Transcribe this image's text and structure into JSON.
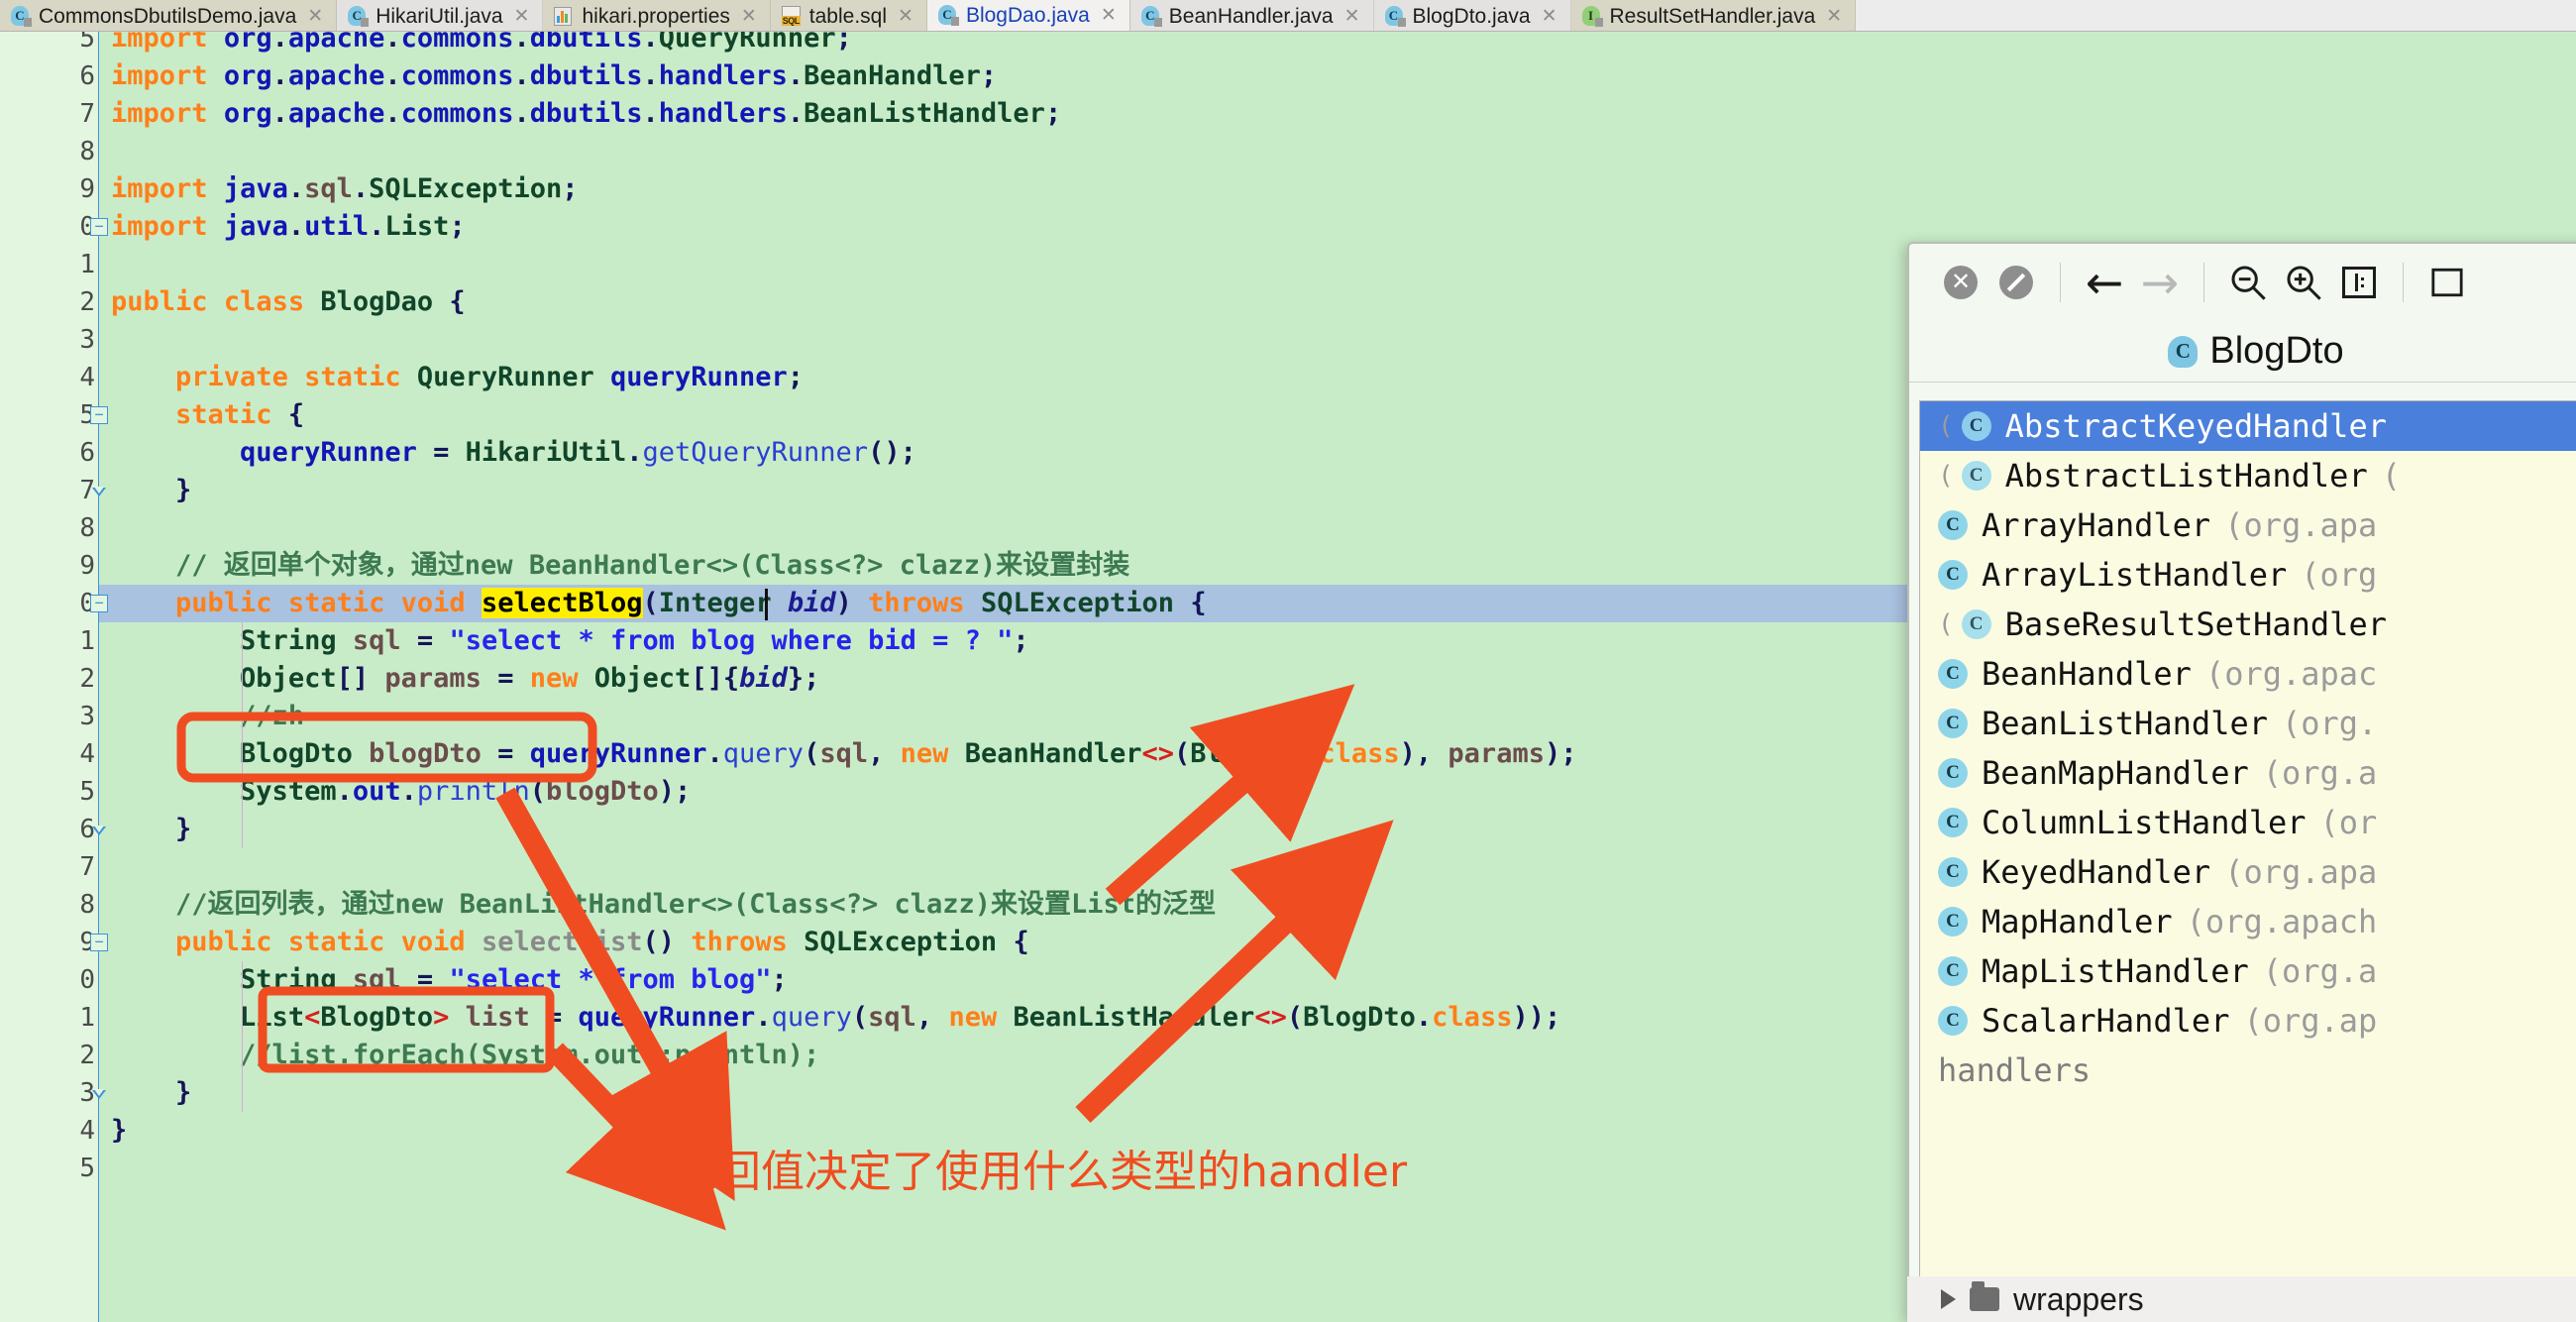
{
  "tabs": [
    {
      "label": "CommonsDbutilsDemo.java",
      "icon": "java-class-icon",
      "kind": "class",
      "active": false,
      "close": "✕"
    },
    {
      "label": "HikariUtil.java",
      "icon": "java-class-icon",
      "kind": "class",
      "active": false,
      "close": "✕"
    },
    {
      "label": "hikari.properties",
      "icon": "properties-file-icon",
      "kind": "props",
      "active": false,
      "close": "✕"
    },
    {
      "label": "table.sql",
      "icon": "sql-file-icon",
      "kind": "sql",
      "active": false,
      "close": "✕"
    },
    {
      "label": "BlogDao.java",
      "icon": "java-class-icon",
      "kind": "class",
      "active": true,
      "close": "✕"
    },
    {
      "label": "BeanHandler.java",
      "icon": "java-class-icon",
      "kind": "class",
      "active": false,
      "close": "✕"
    },
    {
      "label": "BlogDto.java",
      "icon": "java-class-icon",
      "kind": "class",
      "active": false,
      "close": "✕"
    },
    {
      "label": "ResultSetHandler.java",
      "icon": "java-interface-icon",
      "kind": "interface",
      "active": false,
      "close": "✕"
    }
  ],
  "editor": {
    "line_numbers": [
      "5",
      "6",
      "7",
      "8",
      "9",
      "0",
      "1",
      "2",
      "3",
      "4",
      "5",
      "6",
      "7",
      "8",
      "9",
      "0",
      "1",
      "2",
      "3",
      "4",
      "5",
      "6",
      "7",
      "8",
      "9",
      "0",
      "1",
      "2",
      "3",
      "4",
      "5"
    ],
    "caret_line_number": "0",
    "highlighted_token": "selectBlog",
    "lines": [
      "import org.apache.commons.dbutils.QueryRunner;",
      "import org.apache.commons.dbutils.handlers.BeanHandler;",
      "import org.apache.commons.dbutils.handlers.BeanListHandler;",
      "",
      "import java.sql.SQLException;",
      "import java.util.List;",
      "",
      "public class BlogDao {",
      "",
      "    private static QueryRunner queryRunner;",
      "    static {",
      "        queryRunner = HikariUtil.getQueryRunner();",
      "    }",
      "",
      "    // 返回单个对象，通过new BeanHandler<>(Class<?> clazz)来设置封装",
      "    public static void selectBlog(Integer bid) throws SQLException {",
      "        String sql = \"select * from blog where bid = ? \";",
      "        Object[] params = new Object[]{bid};",
      "        //zh",
      "        BlogDto blogDto = queryRunner.query(sql, new BeanHandler<>(BlogDto.class), params);",
      "        System.out.println(blogDto);",
      "    }",
      "",
      "    //返回列表，通过new BeanListHandler<>(Class<?> clazz)来设置List的泛型",
      "    public static void selectList() throws SQLException {",
      "        String sql = \"select * from blog\";",
      "        List<BlogDto> list = queryRunner.query(sql, new BeanListHandler<>(BlogDto.class));",
      "        //list.forEach(System.out::println);",
      "    }",
      "}",
      ""
    ]
  },
  "annotation": {
    "text": "返回值决定了使用什么类型的handler",
    "color": "#ef4d21",
    "boxed_lines": [
      "BlogDto blogDto",
      "List<BlogDto>"
    ]
  },
  "popup": {
    "toolbar": [
      {
        "name": "close-icon",
        "glyph": "✕",
        "kind": "circle",
        "dim": false
      },
      {
        "name": "no-entry-icon",
        "glyph": "",
        "kind": "slash",
        "dim": false
      },
      {
        "name": "back-arrow-icon",
        "glyph": "←",
        "kind": "arrow",
        "dim": false
      },
      {
        "name": "forward-arrow-icon",
        "glyph": "→",
        "kind": "arrow",
        "dim": true
      },
      {
        "name": "zoom-out-icon",
        "glyph": "⊖",
        "kind": "magnify",
        "dim": false
      },
      {
        "name": "zoom-in-icon",
        "glyph": "⊕",
        "kind": "magnify",
        "dim": false
      },
      {
        "name": "fit-width-icon",
        "glyph": "",
        "kind": "box",
        "dim": false
      }
    ],
    "header": {
      "icon_letter": "C",
      "title": "BlogDto"
    },
    "items": [
      {
        "name": "AbstractKeyedHandler",
        "pkg": "",
        "icon": "abstract-class-icon",
        "selected": true
      },
      {
        "name": "AbstractListHandler",
        "pkg": "(",
        "icon": "abstract-class-icon",
        "selected": false
      },
      {
        "name": "ArrayHandler",
        "pkg": "(org.apa",
        "icon": "class-icon",
        "selected": false
      },
      {
        "name": "ArrayListHandler",
        "pkg": "(org",
        "icon": "class-icon",
        "selected": false
      },
      {
        "name": "BaseResultSetHandler",
        "pkg": "",
        "icon": "abstract-class-icon",
        "selected": false
      },
      {
        "name": "BeanHandler",
        "pkg": "(org.apac",
        "icon": "class-icon",
        "selected": false
      },
      {
        "name": "BeanListHandler",
        "pkg": "(org.",
        "icon": "class-icon",
        "selected": false
      },
      {
        "name": "BeanMapHandler",
        "pkg": "(org.a",
        "icon": "class-icon",
        "selected": false
      },
      {
        "name": "ColumnListHandler",
        "pkg": "(or",
        "icon": "class-icon",
        "selected": false
      },
      {
        "name": "KeyedHandler",
        "pkg": "(org.apa",
        "icon": "class-icon",
        "selected": false
      },
      {
        "name": "MapHandler",
        "pkg": "(org.apach",
        "icon": "class-icon",
        "selected": false
      },
      {
        "name": "MapListHandler",
        "pkg": "(org.a",
        "icon": "class-icon",
        "selected": false
      },
      {
        "name": "ScalarHandler",
        "pkg": "(org.ap",
        "icon": "class-icon",
        "selected": false
      }
    ],
    "hidden_row_label": "handlers",
    "tree_row_label": "wrappers"
  },
  "colors": {
    "editor_bg": "#c9ecc8",
    "gutter_bg": "#e2f6e0",
    "caret_line": "#a9c2e0",
    "keyword": "#ff7f1a",
    "type": "#11452a",
    "string": "#2525ee",
    "comment": "#3d7a52",
    "highlight": "#ffee00",
    "annotation": "#ef4d21",
    "popup_select": "#4a7fdc",
    "popup_bg": "#fbfbe2"
  }
}
